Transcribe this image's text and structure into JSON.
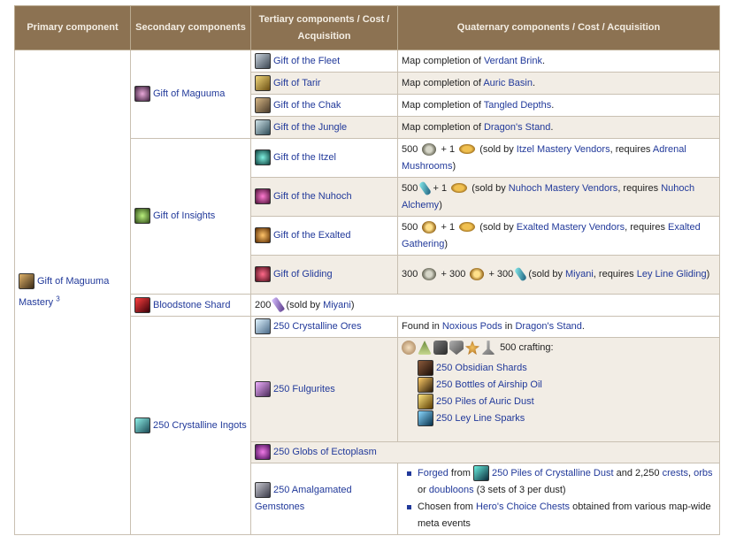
{
  "headers": {
    "primary": "Primary component",
    "secondary": "Secondary components",
    "tertiary": "Tertiary components / Cost / Acquisition",
    "quaternary": "Quaternary components / Cost / Acquisition"
  },
  "primary": {
    "label": "Gift of Maguuma Mastery",
    "sup": "3",
    "icon": "mastery-icon"
  },
  "gift_of_maguuma": {
    "label": "Gift of Maguuma",
    "rows": [
      {
        "name": "Gift of the Fleet",
        "pre": "Map completion of ",
        "link": "Verdant Brink",
        "post": "."
      },
      {
        "name": "Gift of Tarir",
        "pre": "Map completion of ",
        "link": "Auric Basin",
        "post": "."
      },
      {
        "name": "Gift of the Chak",
        "pre": "Map completion of ",
        "link": "Tangled Depths",
        "post": "."
      },
      {
        "name": "Gift of the Jungle",
        "pre": "Map completion of ",
        "link": "Dragon's Stand",
        "post": "."
      }
    ]
  },
  "gift_of_insights": {
    "label": "Gift of Insights",
    "rows": [
      {
        "name": "Gift of the Itzel",
        "qty": "500",
        "plus": "+ 1",
        "sold_pre": "(sold by ",
        "vendor": "Itzel Mastery Vendors",
        "req": ", requires ",
        "req_link": "Adrenal Mushrooms",
        "end": ")"
      },
      {
        "name": "Gift of the Nuhoch",
        "qty": "500",
        "plus": "+ 1",
        "sold_pre": "(sold by ",
        "vendor": "Nuhoch Mastery Vendors",
        "req": ", requires ",
        "req_link": "Nuhoch Alchemy",
        "end": ")"
      },
      {
        "name": "Gift of the Exalted",
        "qty": "500",
        "plus": "+ 1",
        "sold_pre": "(sold by ",
        "vendor": "Exalted Mastery Vendors",
        "req": ", requires ",
        "req_link": "Exalted Gathering",
        "end": ")"
      },
      {
        "name": "Gift of Gliding",
        "qty": "300",
        "plus2": "+ 300",
        "plus3": "+ 300",
        "sold_pre": "(sold by ",
        "vendor": "Miyani",
        "req": ", requires ",
        "req_link": "Ley Line Gliding",
        "end": ")"
      }
    ]
  },
  "bloodstone": {
    "label": "Bloodstone Shard",
    "qty": "200",
    "sold_pre": "(sold by ",
    "vendor": "Miyani",
    "end": ")"
  },
  "ingots": {
    "label": "250 Crystalline Ingots",
    "ores": {
      "name": "250 Crystalline Ores",
      "pre": "Found in ",
      "link1": "Noxious Pods",
      "mid": " in ",
      "link2": "Dragon's Stand",
      "post": "."
    },
    "fulgurites": {
      "name": "250 Fulgurites",
      "crafting": "500 crafting:",
      "items": [
        "250 Obsidian Shards",
        "250 Bottles of Airship Oil",
        "250 Piles of Auric Dust",
        "250 Ley Line Sparks"
      ]
    },
    "ecto": {
      "name": "250 Globs of Ectoplasm"
    },
    "gemstones": {
      "name": "250 Amalgamated Gemstones",
      "b1_link": "Forged",
      "b1_from": " from ",
      "b1_item": "250 Piles of Crystalline Dust",
      "b1_and": " and 2,250 ",
      "b1_crests": "crests",
      "b1_comma": ", ",
      "b1_orbs": "orbs",
      "b1_or": " or ",
      "b1_doubloons": "doubloons",
      "b1_tail": " (3 sets of 3 per dust)",
      "b2_pre": "Chosen from ",
      "b2_link": "Hero's Choice Chests",
      "b2_post": " obtained from various map-wide meta events"
    }
  }
}
